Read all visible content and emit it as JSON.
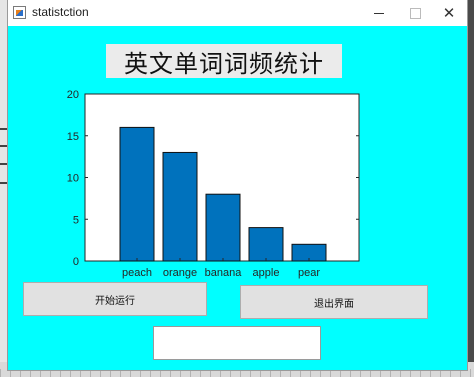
{
  "window": {
    "title": "statistction"
  },
  "heading": "英文单词词频统计",
  "buttons": {
    "start_label": "开始运行",
    "exit_label": "退出界面"
  },
  "result_text": "",
  "colors": {
    "window_bg": "#00ffff",
    "bar_fill": "#0072bd"
  },
  "chart_data": {
    "type": "bar",
    "categories": [
      "peach",
      "orange",
      "banana",
      "apple",
      "pear"
    ],
    "values": [
      16,
      13,
      8,
      4,
      2
    ],
    "title": "",
    "xlabel": "",
    "ylabel": "",
    "ylim": [
      0,
      20
    ],
    "yticks": [
      0,
      5,
      10,
      15,
      20
    ],
    "grid": false
  }
}
